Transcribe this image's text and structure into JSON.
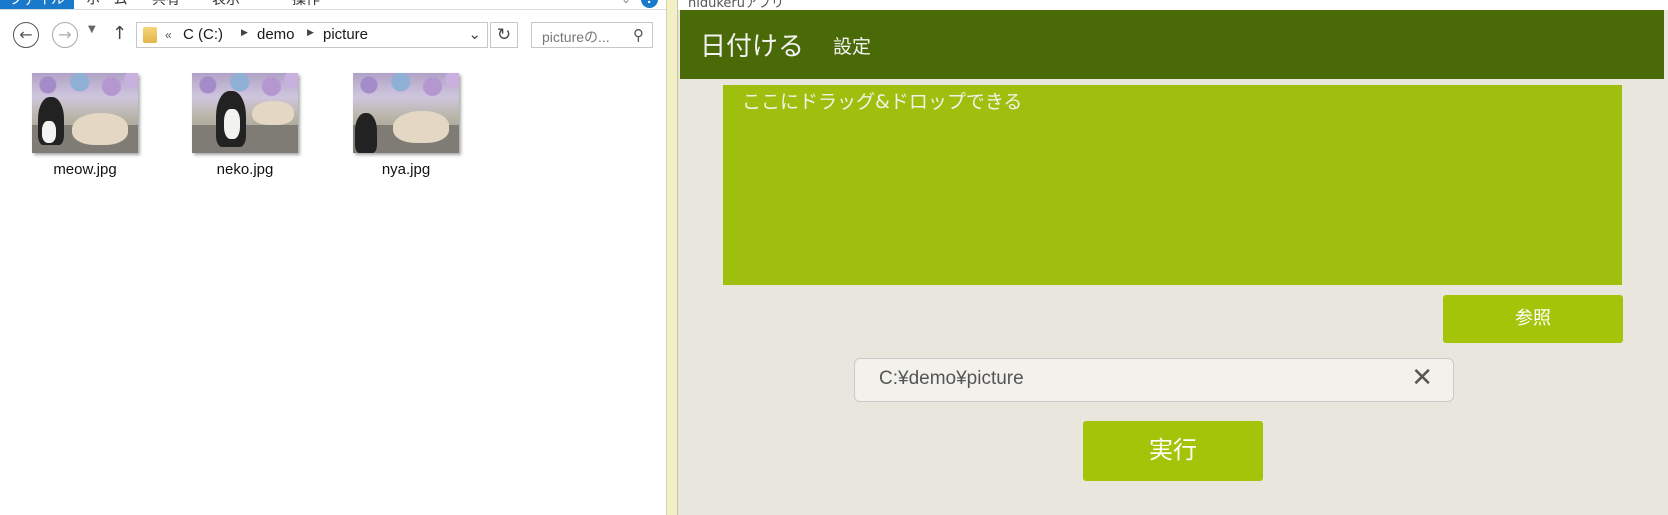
{
  "explorer": {
    "ribbon": {
      "tabs": [
        "ファイル",
        "ホーム",
        "共有",
        "表示",
        "操作"
      ]
    },
    "nav": {
      "back_icon": "arrow-left-icon",
      "forward_icon": "arrow-right-icon",
      "history_icon": "chevron-down-icon",
      "up_icon": "arrow-up-icon"
    },
    "address": {
      "overflow": "«",
      "segments": [
        "C (C:)",
        "demo",
        "picture"
      ]
    },
    "search": {
      "placeholder": "pictureの..."
    },
    "files": [
      {
        "name": "meow.jpg"
      },
      {
        "name": "neko.jpg"
      },
      {
        "name": "nya.jpg"
      }
    ]
  },
  "app": {
    "window_title": "hidukeruアプリ",
    "brand": "日付ける",
    "menu": {
      "settings": "設定"
    },
    "dropzone": {
      "text": "ここにドラッグ&ドロップできる"
    },
    "browse_label": "参照",
    "path": {
      "value": "C:¥demo¥picture"
    },
    "run_label": "実行",
    "colors": {
      "header": "#4a6a08",
      "dropzone": "#9fbf0f",
      "button": "#a4c40a",
      "background": "#e9e7dd"
    }
  }
}
